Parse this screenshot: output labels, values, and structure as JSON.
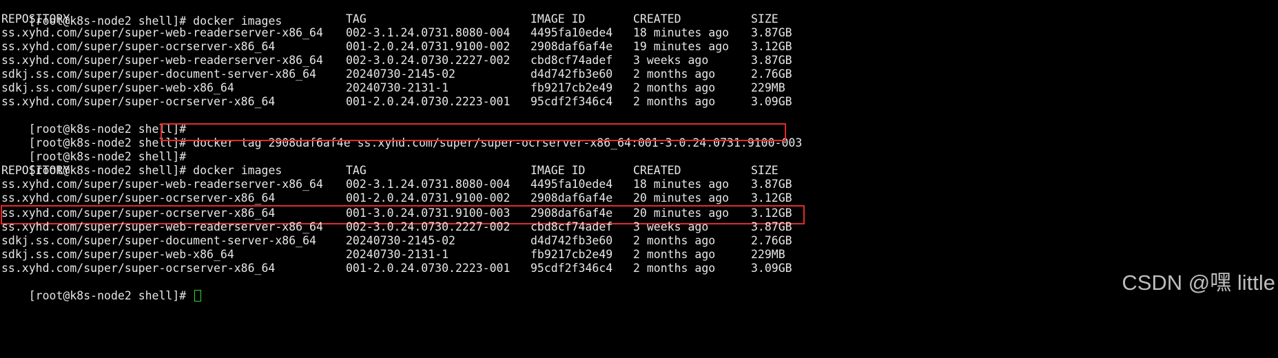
{
  "prompt": "[root@k8s-node2 shell]# ",
  "commands": {
    "images_first": "docker images",
    "tag": "docker tag 2908daf6af4e ss.xyhd.com/super/super-ocrserver-x86_64:001-3.0.24.0731.9100-003",
    "images_second": "docker images"
  },
  "table_headers": {
    "repository": "REPOSITORY",
    "tag": "TAG",
    "image_id": "IMAGE ID",
    "created": "CREATED",
    "size": "SIZE"
  },
  "first_listing": [
    {
      "repository": "ss.xyhd.com/super/super-web-readerserver-x86_64",
      "tag": "002-3.1.24.0731.8080-004",
      "image_id": "4495fa10ede4",
      "created": "18 minutes ago",
      "size": "3.87GB"
    },
    {
      "repository": "ss.xyhd.com/super/super-ocrserver-x86_64",
      "tag": "001-2.0.24.0731.9100-002",
      "image_id": "2908daf6af4e",
      "created": "19 minutes ago",
      "size": "3.12GB"
    },
    {
      "repository": "ss.xyhd.com/super/super-web-readerserver-x86_64",
      "tag": "002-3.0.24.0730.2227-002",
      "image_id": "cbd8cf74adef",
      "created": "3 weeks ago",
      "size": "3.87GB"
    },
    {
      "repository": "sdkj.ss.com/super/super-document-server-x86_64",
      "tag": "20240730-2145-02",
      "image_id": "d4d742fb3e60",
      "created": "2 months ago",
      "size": "2.76GB"
    },
    {
      "repository": "sdkj.ss.com/super/super-web-x86_64",
      "tag": "20240730-2131-1",
      "image_id": "fb9217cb2e49",
      "created": "2 months ago",
      "size": "229MB"
    },
    {
      "repository": "ss.xyhd.com/super/super-ocrserver-x86_64",
      "tag": "001-2.0.24.0730.2223-001",
      "image_id": "95cdf2f346c4",
      "created": "2 months ago",
      "size": "3.09GB"
    }
  ],
  "second_listing": [
    {
      "repository": "ss.xyhd.com/super/super-web-readerserver-x86_64",
      "tag": "002-3.1.24.0731.8080-004",
      "image_id": "4495fa10ede4",
      "created": "18 minutes ago",
      "size": "3.87GB"
    },
    {
      "repository": "ss.xyhd.com/super/super-ocrserver-x86_64",
      "tag": "001-2.0.24.0731.9100-002",
      "image_id": "2908daf6af4e",
      "created": "20 minutes ago",
      "size": "3.12GB"
    },
    {
      "repository": "ss.xyhd.com/super/super-ocrserver-x86_64",
      "tag": "001-3.0.24.0731.9100-003",
      "image_id": "2908daf6af4e",
      "created": "20 minutes ago",
      "size": "3.12GB"
    },
    {
      "repository": "ss.xyhd.com/super/super-web-readerserver-x86_64",
      "tag": "002-3.0.24.0730.2227-002",
      "image_id": "cbd8cf74adef",
      "created": "3 weeks ago",
      "size": "3.87GB"
    },
    {
      "repository": "sdkj.ss.com/super/super-document-server-x86_64",
      "tag": "20240730-2145-02",
      "image_id": "d4d742fb3e60",
      "created": "2 months ago",
      "size": "2.76GB"
    },
    {
      "repository": "sdkj.ss.com/super/super-web-x86_64",
      "tag": "20240730-2131-1",
      "image_id": "fb9217cb2e49",
      "created": "2 months ago",
      "size": "229MB"
    },
    {
      "repository": "ss.xyhd.com/super/super-ocrserver-x86_64",
      "tag": "001-2.0.24.0730.2223-001",
      "image_id": "95cdf2f346c4",
      "created": "2 months ago",
      "size": "3.09GB"
    }
  ],
  "watermark": "CSDN @嘿 little",
  "colors": {
    "background": "#000000",
    "text": "#e6e6e6",
    "highlight": "#e32b2b",
    "cursor": "#3ad13a"
  }
}
